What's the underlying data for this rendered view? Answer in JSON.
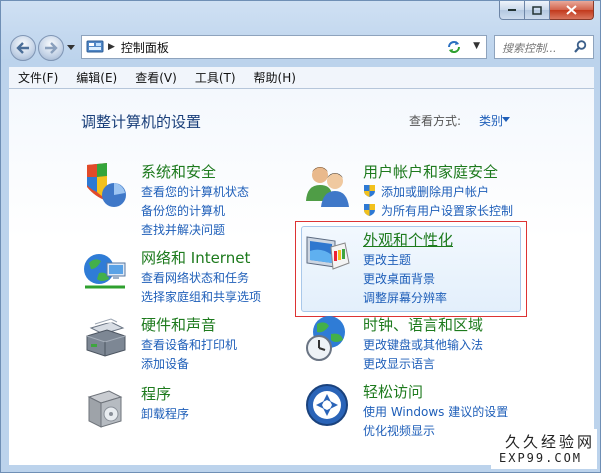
{
  "address": {
    "path": "控制面板"
  },
  "search": {
    "placeholder": "搜索控制..."
  },
  "menu": [
    "文件(F)",
    "编辑(E)",
    "查看(V)",
    "工具(T)",
    "帮助(H)"
  ],
  "page_title": "调整计算机的设置",
  "view_by": {
    "label": "查看方式:",
    "value": "类别"
  },
  "categories": [
    {
      "title": "系统和安全",
      "links": [
        "查看您的计算机状态",
        "备份您的计算机",
        "查找并解决问题"
      ]
    },
    {
      "title": "网络和 Internet",
      "links": [
        "查看网络状态和任务",
        "选择家庭组和共享选项"
      ]
    },
    {
      "title": "硬件和声音",
      "links": [
        "查看设备和打印机",
        "添加设备"
      ]
    },
    {
      "title": "程序",
      "links": [
        "卸载程序"
      ]
    },
    {
      "title": "用户帐户和家庭安全",
      "links": [
        "添加或删除用户帐户",
        "为所有用户设置家长控制"
      ]
    },
    {
      "title": "外观和个性化",
      "links": [
        "更改主题",
        "更改桌面背景",
        "调整屏幕分辨率"
      ]
    },
    {
      "title": "时钟、语言和区域",
      "links": [
        "更改键盘或其他输入法",
        "更改显示语言"
      ]
    },
    {
      "title": "轻松访问",
      "links": [
        "使用 Windows 建议的设置",
        "优化视频显示"
      ]
    }
  ],
  "watermark": {
    "line1": "久久经验网",
    "line2": "EXP99.COM"
  },
  "colors": {
    "category_title": "#1d7a1d",
    "link": "#1f5fb9",
    "highlight_border": "#dd3333"
  }
}
